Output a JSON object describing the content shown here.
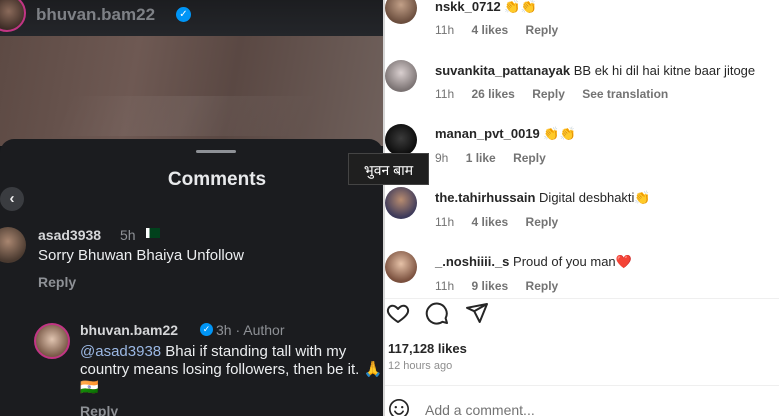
{
  "story": {
    "username": "bhuvan.bam22",
    "sheet_title": "Comments",
    "back_glyph": "‹",
    "comments": [
      {
        "user": "asad3938",
        "time": "5h",
        "text": "Sorry Bhuwan Bhaiya Unfollow",
        "reply": "Reply"
      },
      {
        "user": "bhuvan.bam22",
        "time": "3h · Author",
        "mention": "@asad3938",
        "text": " Bhai if standing tall with my country means losing followers, then be it. 🙏 🇮🇳",
        "reply": "Reply"
      }
    ]
  },
  "tooltip": "भुवन बाम",
  "comments": [
    {
      "user": "nskk_0712",
      "text": "👏👏",
      "time": "11h",
      "likes": "4 likes",
      "reply": "Reply",
      "extra": ""
    },
    {
      "user": "suvankita_pattanayak",
      "text": "BB ek hi dil hai kitne baar jitoge",
      "time": "11h",
      "likes": "26 likes",
      "reply": "Reply",
      "extra": "See translation"
    },
    {
      "user": "manan_pvt_0019",
      "text": "👏👏",
      "time": "9h",
      "likes": "1 like",
      "reply": "Reply",
      "extra": ""
    },
    {
      "user": "the.tahirhussain",
      "text": "Digital desbhakti👏",
      "time": "11h",
      "likes": "4 likes",
      "reply": "Reply",
      "extra": ""
    },
    {
      "user": "_.noshiiii._s",
      "text": "Proud of you man❤️",
      "time": "11h",
      "likes": "9 likes",
      "reply": "Reply",
      "extra": ""
    }
  ],
  "post": {
    "likes": "117,128 likes",
    "ago": "12 hours ago",
    "add_comment_placeholder": "Add a comment..."
  },
  "icons": [
    "heart-icon",
    "comment-icon",
    "share-icon",
    "emoji-icon",
    "verified-icon",
    "back-icon"
  ]
}
